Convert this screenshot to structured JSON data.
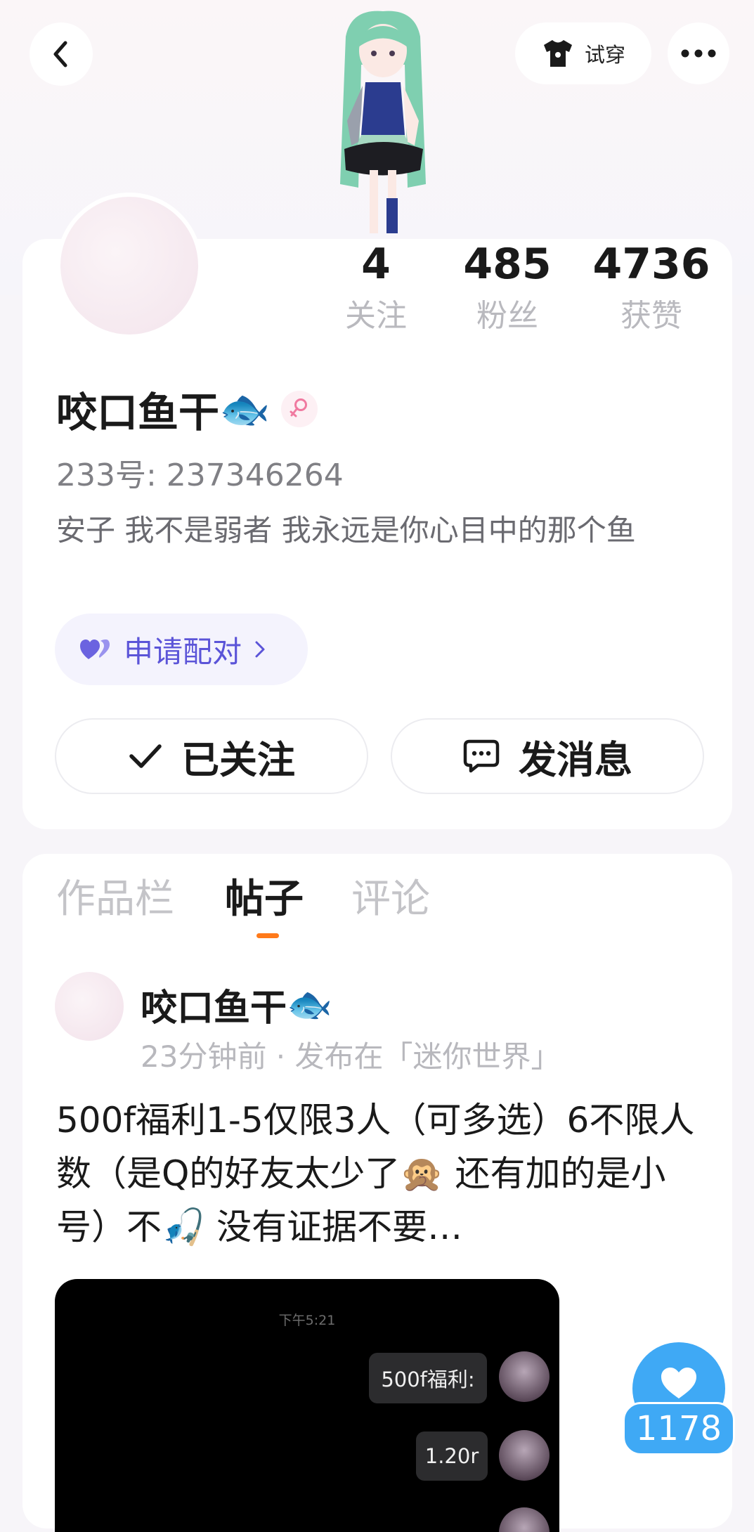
{
  "header": {
    "try_on_label": "试穿",
    "back_icon": "chevron-left-icon",
    "tryon_icon": "shirt-icon",
    "more_icon": "more-dots-icon"
  },
  "profile": {
    "name": "咬口鱼干",
    "name_emoji": "🐟",
    "gender_icon": "female-icon",
    "uid": "233号: 237346264",
    "bio": "安子 我不是弱者 我永远是你心目中的那个鱼",
    "stats": [
      {
        "value": "4",
        "label": "关注"
      },
      {
        "value": "485",
        "label": "粉丝"
      },
      {
        "value": "4736",
        "label": "获赞"
      }
    ],
    "pair_label": "申请配对",
    "followed_label": "已关注",
    "message_label": "发消息"
  },
  "tabs": [
    {
      "label": "作品栏",
      "active": false
    },
    {
      "label": "帖子",
      "active": true
    },
    {
      "label": "评论",
      "active": false
    }
  ],
  "post": {
    "author": "咬口鱼干",
    "author_emoji": "🐟",
    "meta": "23分钟前 · 发布在「迷你世界」",
    "text": "500f福利1-5仅限3人（可多选）6不限人数（是Q的好友太少了🙊 还有加的是小号）不🎣 没有证据不要…",
    "image": {
      "time": "下午5:21",
      "bubbles": [
        "500f福利:",
        "1.20r"
      ]
    }
  },
  "like": {
    "count": "1178"
  },
  "colors": {
    "accent_orange": "#ff7a1a",
    "like_blue": "#3fa9f5",
    "pair_purple": "#5b54d8"
  }
}
